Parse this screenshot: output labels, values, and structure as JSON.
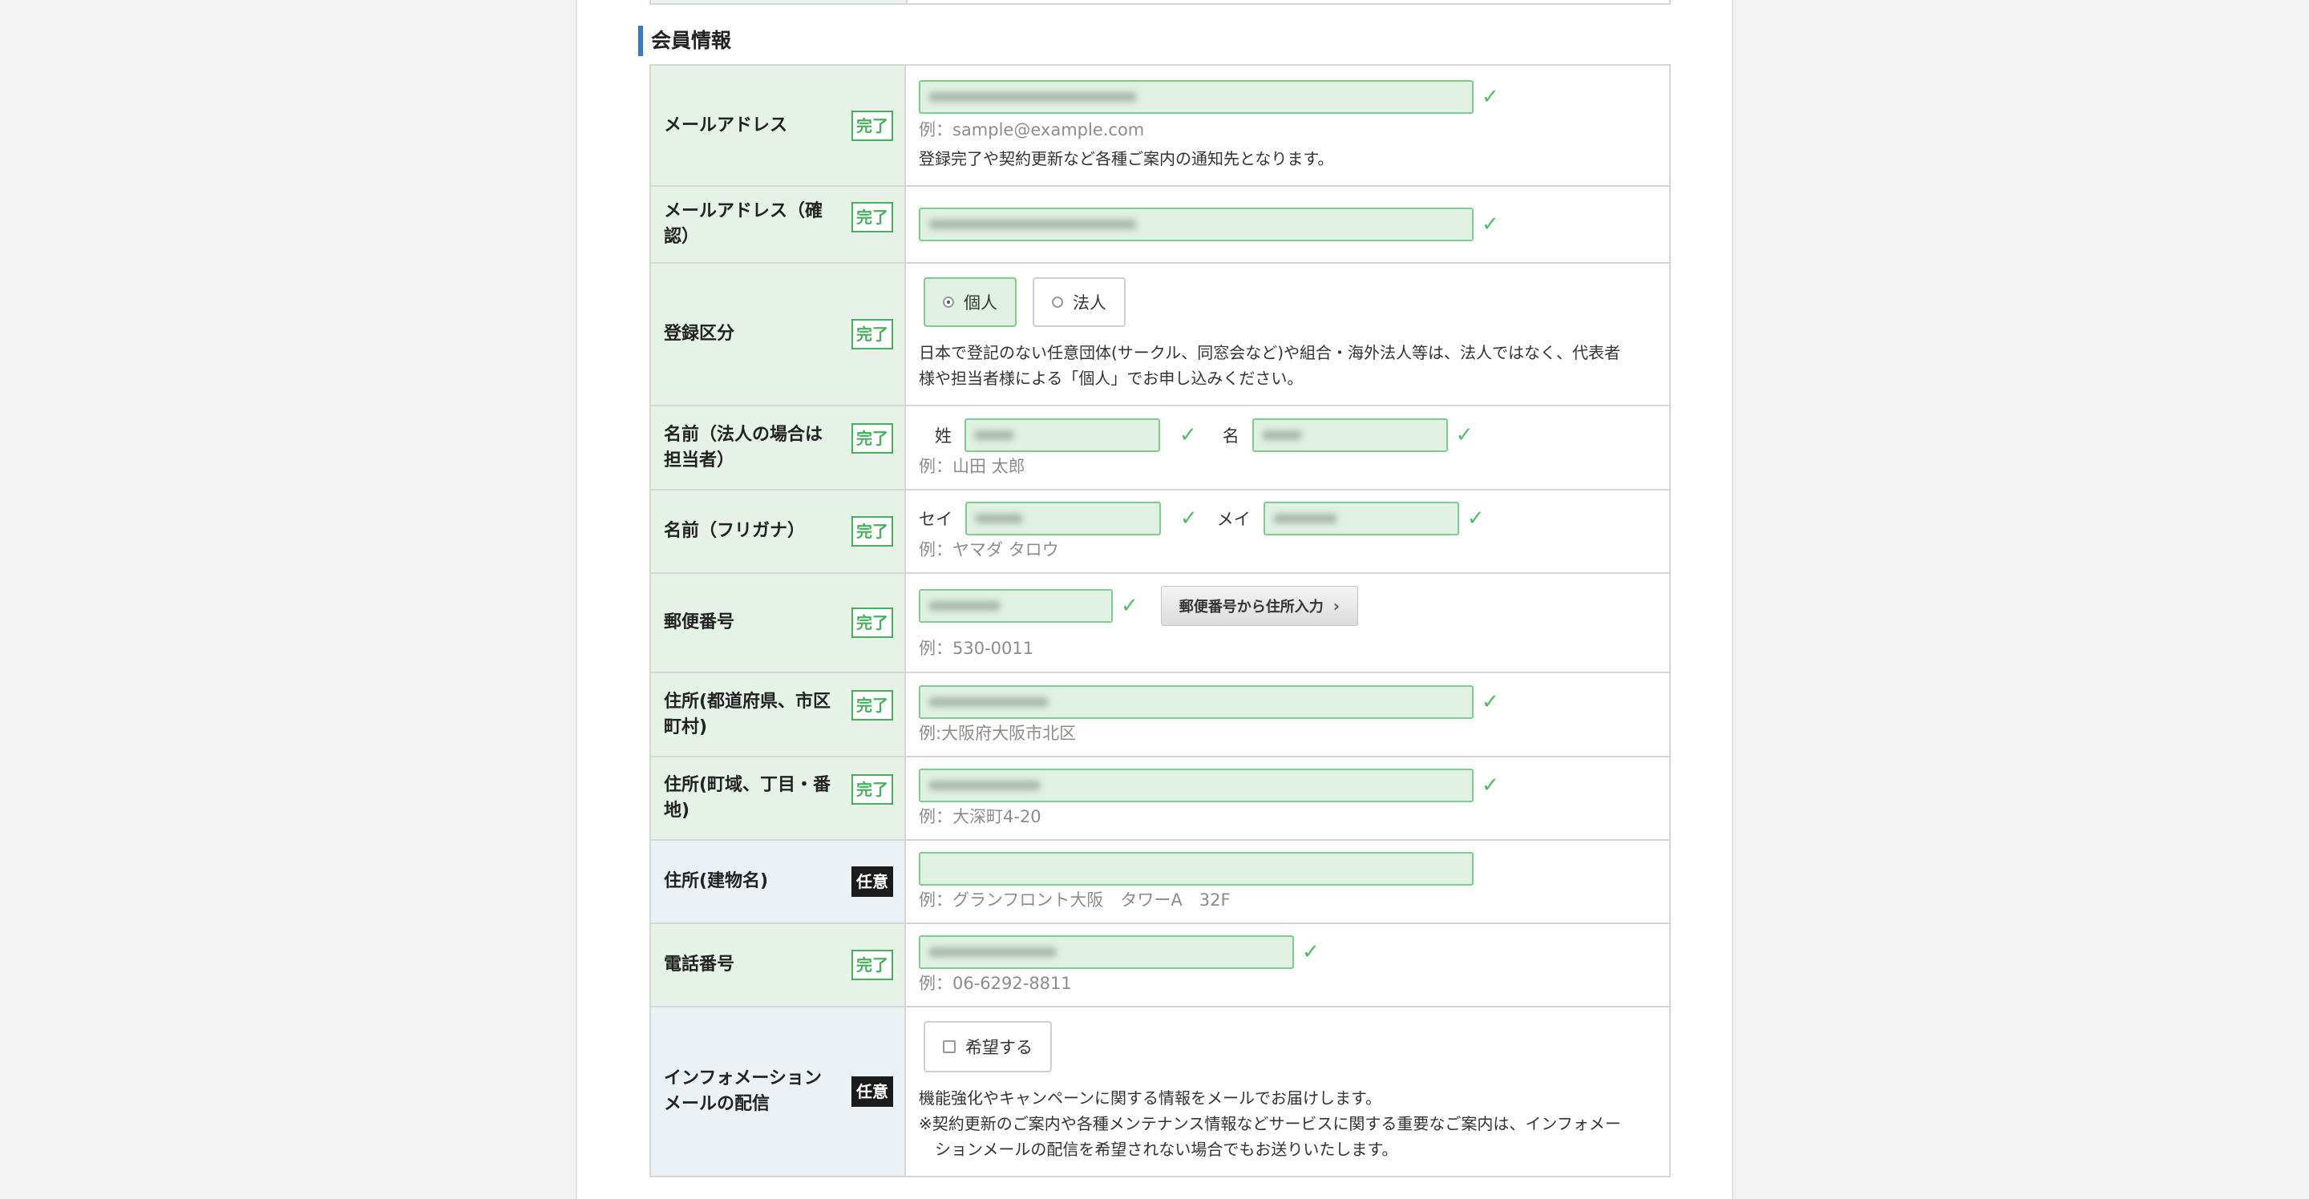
{
  "section_title": "会員情報",
  "badges": {
    "done": "完了",
    "optional": "任意"
  },
  "check": "✓",
  "rows": {
    "email": {
      "label": "メールアドレス",
      "example": "例：sample@example.com",
      "note": "登録完了や契約更新など各種ご案内の通知先となります。"
    },
    "email_confirm": {
      "label": "メールアドレス（確認）"
    },
    "reg_type": {
      "label": "登録区分",
      "options": [
        "個人",
        "法人"
      ],
      "selected": "個人",
      "note_line1": "日本で登記のない任意団体(サークル、同窓会など)や組合・海外法人等は、法人ではなく、代表者",
      "note_line2": "様や担当者様による「個人」でお申し込みください。"
    },
    "name": {
      "label": "名前（法人の場合は担当者）",
      "last_label": "姓",
      "first_label": "名",
      "example": "例：山田 太郎"
    },
    "name_kana": {
      "label": "名前（フリガナ）",
      "last_label": "セイ",
      "first_label": "メイ",
      "example": "例：ヤマダ タロウ"
    },
    "zip": {
      "label": "郵便番号",
      "button": "郵便番号から住所入力",
      "example": "例：530-0011"
    },
    "addr1": {
      "label": "住所(都道府県、市区町村)",
      "example": "例:大阪府大阪市北区"
    },
    "addr2": {
      "label": "住所(町域、丁目・番地)",
      "example": "例：大深町4-20"
    },
    "addr3": {
      "label": "住所(建物名)",
      "example": "例：グランフロント大阪　タワーA　32F"
    },
    "tel": {
      "label": "電話番号",
      "example": "例：06-6292-8811"
    },
    "newsletter": {
      "label": "インフォメーションメールの配信",
      "checkbox": "希望する",
      "checked": false,
      "note1": "機能強化やキャンペーンに関する情報をメールでお届けします。",
      "note2": "※契約更新のご案内や各種メンテナンス情報などサービスに関する重要なご案内は、インフォメー",
      "note3": "ションメールの配信を希望されない場合でもお送りいたします。"
    }
  }
}
